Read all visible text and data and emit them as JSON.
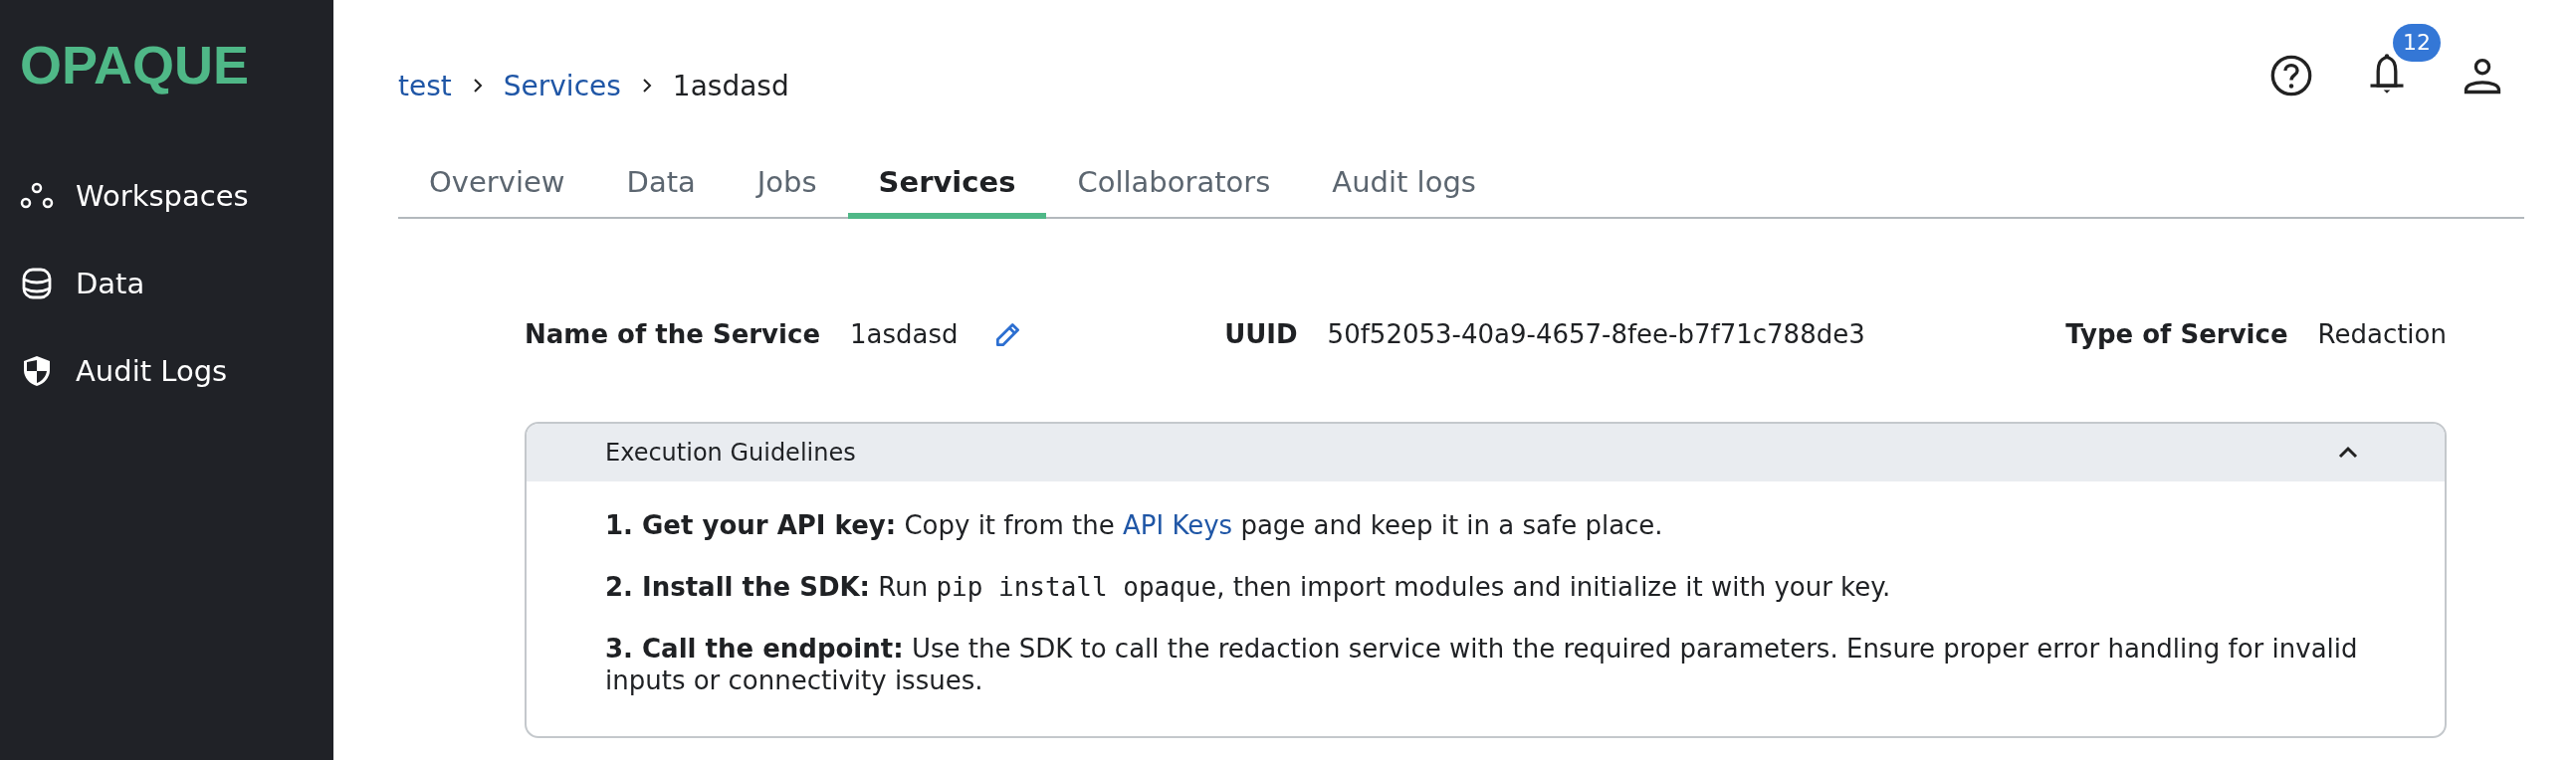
{
  "sidebar": {
    "logo": "OPAQUE",
    "items": [
      {
        "label": "Workspaces",
        "kind": "workspaces"
      },
      {
        "label": "Data",
        "kind": "data"
      },
      {
        "label": "Audit Logs",
        "kind": "audit"
      }
    ]
  },
  "breadcrumb": [
    {
      "label": "test",
      "current": false
    },
    {
      "label": "Services",
      "current": false
    },
    {
      "label": "1asdasd",
      "current": true
    }
  ],
  "header": {
    "notifications_badge": "12"
  },
  "tabs": [
    {
      "label": "Overview",
      "selected": false
    },
    {
      "label": "Data",
      "selected": false
    },
    {
      "label": "Jobs",
      "selected": false
    },
    {
      "label": "Services",
      "selected": true
    },
    {
      "label": "Collaborators",
      "selected": false
    },
    {
      "label": "Audit logs",
      "selected": false
    }
  ],
  "service": {
    "fields": [
      {
        "label": "Name of the Service",
        "value": "1asdasd",
        "editable": true
      },
      {
        "label": "UUID",
        "value": "50f52053-40a9-4657-8fee-b7f71c788de3",
        "editable": false
      },
      {
        "label": "Type of Service",
        "value": "Redaction",
        "editable": false
      }
    ]
  },
  "guidelines": {
    "title": "Execution Guidelines",
    "expanded": true,
    "steps": [
      [
        {
          "kind": "bold",
          "text": "1. Get your API key:"
        },
        {
          "kind": "text",
          "text": " Copy it from the "
        },
        {
          "kind": "link",
          "text": "API Keys"
        },
        {
          "kind": "text",
          "text": " page and keep it in a safe place."
        }
      ],
      [
        {
          "kind": "bold",
          "text": "2. Install the SDK:"
        },
        {
          "kind": "text",
          "text": " Run "
        },
        {
          "kind": "code",
          "text": "pip install opaque"
        },
        {
          "kind": "text",
          "text": ", then import modules and initialize it with your key."
        }
      ],
      [
        {
          "kind": "bold",
          "text": "3. Call the endpoint:"
        },
        {
          "kind": "text",
          "text": " Use the SDK to call the redaction service with the required parameters. Ensure proper error handling for invalid inputs or connectivity issues."
        }
      ]
    ]
  }
}
